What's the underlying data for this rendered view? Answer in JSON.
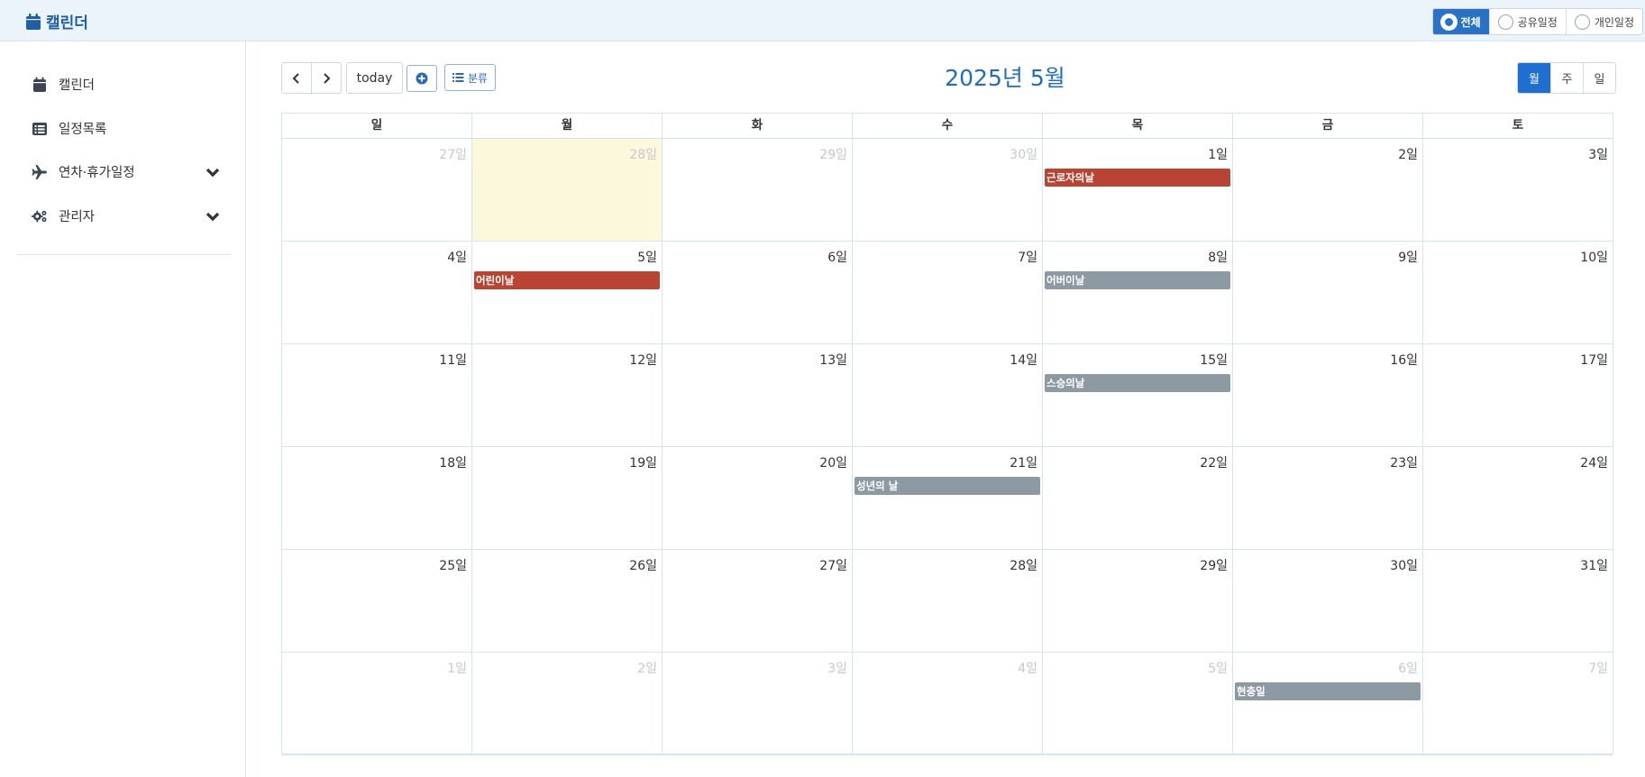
{
  "app": {
    "title": "캘린더"
  },
  "filters": [
    {
      "label": "전체",
      "active": true
    },
    {
      "label": "공유일정",
      "active": false
    },
    {
      "label": "개인일정",
      "active": false
    }
  ],
  "sidebar": {
    "items": [
      {
        "label": "캘린더",
        "icon": "calendar-icon"
      },
      {
        "label": "일정목록",
        "icon": "list-icon"
      },
      {
        "label": "연차·휴가일정",
        "icon": "plane-icon",
        "expandable": true
      },
      {
        "label": "관리자",
        "icon": "gears-icon",
        "expandable": true
      }
    ]
  },
  "toolbar": {
    "today_label": "today",
    "category_label": "분류",
    "title": "2025년 5월",
    "views": [
      {
        "label": "월",
        "active": true
      },
      {
        "label": "주",
        "active": false
      },
      {
        "label": "일",
        "active": false
      }
    ]
  },
  "calendar": {
    "weekdays": [
      "일",
      "월",
      "화",
      "수",
      "목",
      "금",
      "토"
    ],
    "weeks": [
      [
        {
          "label": "27일",
          "other": true
        },
        {
          "label": "28일",
          "other": true,
          "today": true
        },
        {
          "label": "29일",
          "other": true
        },
        {
          "label": "30일",
          "other": true
        },
        {
          "label": "1일"
        },
        {
          "label": "2일"
        },
        {
          "label": "3일"
        }
      ],
      [
        {
          "label": "4일"
        },
        {
          "label": "5일"
        },
        {
          "label": "6일"
        },
        {
          "label": "7일"
        },
        {
          "label": "8일"
        },
        {
          "label": "9일"
        },
        {
          "label": "10일"
        }
      ],
      [
        {
          "label": "11일"
        },
        {
          "label": "12일"
        },
        {
          "label": "13일"
        },
        {
          "label": "14일"
        },
        {
          "label": "15일"
        },
        {
          "label": "16일"
        },
        {
          "label": "17일"
        }
      ],
      [
        {
          "label": "18일"
        },
        {
          "label": "19일"
        },
        {
          "label": "20일"
        },
        {
          "label": "21일"
        },
        {
          "label": "22일"
        },
        {
          "label": "23일"
        },
        {
          "label": "24일"
        }
      ],
      [
        {
          "label": "25일"
        },
        {
          "label": "26일"
        },
        {
          "label": "27일"
        },
        {
          "label": "28일"
        },
        {
          "label": "29일"
        },
        {
          "label": "30일"
        },
        {
          "label": "31일"
        }
      ],
      [
        {
          "label": "1일",
          "other": true
        },
        {
          "label": "2일",
          "other": true
        },
        {
          "label": "3일",
          "other": true
        },
        {
          "label": "4일",
          "other": true
        },
        {
          "label": "5일",
          "other": true
        },
        {
          "label": "6일",
          "other": true
        },
        {
          "label": "7일",
          "other": true
        }
      ]
    ],
    "events": [
      {
        "week": 0,
        "day": 4,
        "title": "근로자의날",
        "color": "#b94433"
      },
      {
        "week": 1,
        "day": 1,
        "title": "어린이날",
        "color": "#b94433"
      },
      {
        "week": 1,
        "day": 4,
        "title": "어버이날",
        "color": "#8d9aa4"
      },
      {
        "week": 2,
        "day": 4,
        "title": "스승의날",
        "color": "#8d9aa4"
      },
      {
        "week": 3,
        "day": 3,
        "title": "성년의 날",
        "color": "#8d9aa4"
      },
      {
        "week": 5,
        "day": 5,
        "title": "현충일",
        "color": "#8d9aa4"
      }
    ]
  },
  "colors": {
    "accent": "#1e6fd0",
    "today_bg": "#fcf8dc",
    "holiday": "#b94433",
    "memorial": "#8d9aa4"
  }
}
